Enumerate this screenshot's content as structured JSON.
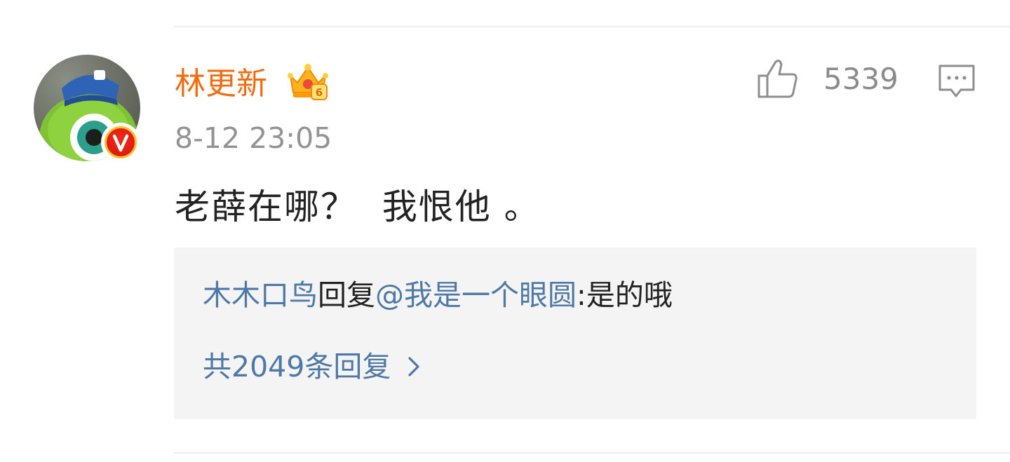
{
  "comment": {
    "username": "林更新",
    "vip_level": "6",
    "timestamp": "8-12 23:05",
    "like_count": "5339",
    "text": "老薛在哪？  我恨他 。",
    "verified_badge": "V"
  },
  "reply": {
    "author": "木木口鸟",
    "action": "回复",
    "mention": "@我是一个眼圆",
    "text": ":是的哦",
    "more_label": "共2049条回复"
  },
  "colors": {
    "username": "#f26b0f",
    "link": "#4e78a6",
    "meta": "#939393",
    "reply_bg": "#f4f4f4"
  },
  "icons": {
    "like": "thumbs-up-icon",
    "comment": "comment-bubble-icon",
    "vip": "crown-icon",
    "more": "chevron-right-icon"
  }
}
